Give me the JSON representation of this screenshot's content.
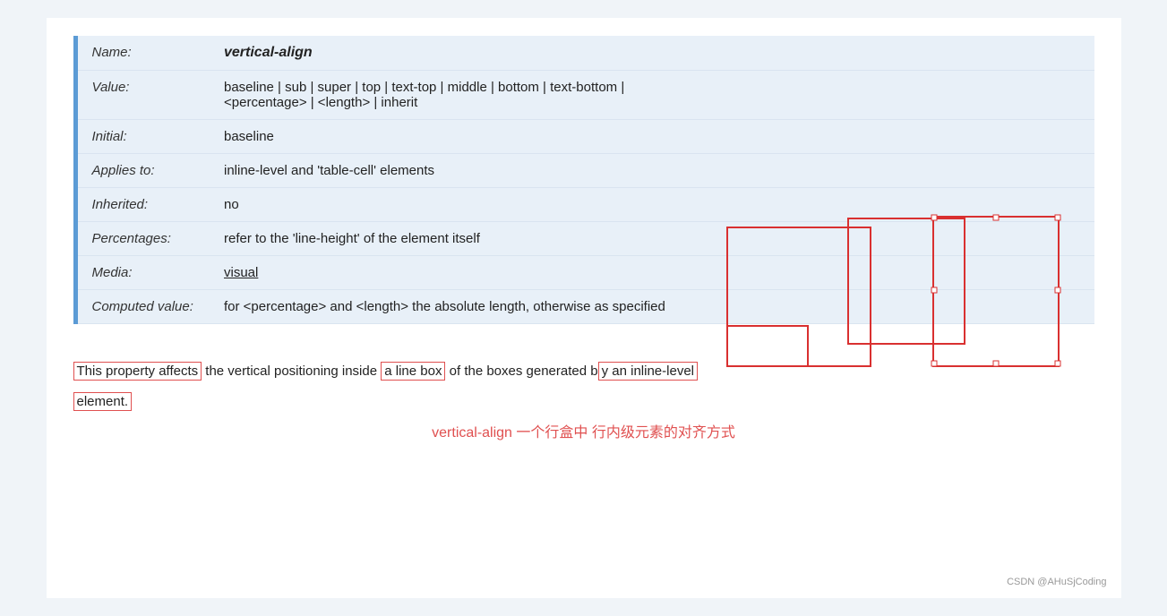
{
  "table": {
    "rows": [
      {
        "label": "Name:",
        "value": "vertical-align",
        "isName": true
      },
      {
        "label": "Value:",
        "value": "baseline | sub | super | top | text-top | middle | bottom | text-bottom | <percentage> | <length> | inherit",
        "hasUnderline": false
      },
      {
        "label": "Initial:",
        "value": "baseline"
      },
      {
        "label": "Applies to:",
        "value": "inline-level and 'table-cell' elements"
      },
      {
        "label": "Inherited:",
        "value": "no"
      },
      {
        "label": "Percentages:",
        "value": "refer to the 'line-height' of the element itself"
      },
      {
        "label": "Media:",
        "value": "visual",
        "hasUnderline": true
      },
      {
        "label": "Computed value:",
        "value": "for <percentage> and <length> the absolute length, otherwise as specified"
      }
    ]
  },
  "bottom": {
    "text1_pre": "This property affects",
    "text1_mid1": " the vertical positioning inside ",
    "text1_box1": "a line box",
    "text1_mid2": " of the boxes generated b",
    "text1_box2": "y an inline-level",
    "text2": "element.",
    "subtitle": "vertical-align 一个行盒中 行内级元素的对齐方式"
  },
  "watermark": "CSDN @AHuSjCoding"
}
